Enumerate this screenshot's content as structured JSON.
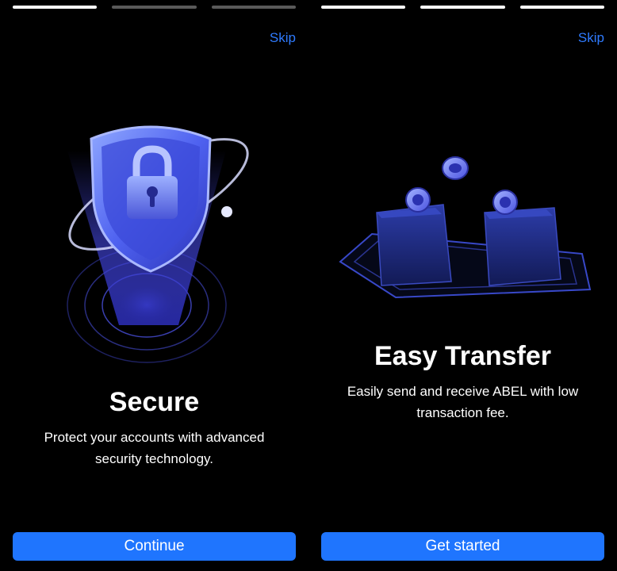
{
  "screen1": {
    "progress": [
      true,
      false,
      false
    ],
    "skip_label": "Skip",
    "illustration_icon": "shield-lock-icon",
    "title": "Secure",
    "description": "Protect your accounts with advanced security technology.",
    "cta_label": "Continue"
  },
  "screen2": {
    "progress": [
      true,
      true,
      true
    ],
    "skip_label": "Skip",
    "illustration_icon": "wallet-transfer-icon",
    "title": "Easy Transfer",
    "description": "Easily send and receive ABEL with low transaction fee.",
    "cta_label": "Get started"
  },
  "colors": {
    "accent": "#1f75fe",
    "skip": "#2f7bff",
    "background": "#000000",
    "progress_active": "#ffffff",
    "progress_inactive": "#5a5a5a"
  }
}
